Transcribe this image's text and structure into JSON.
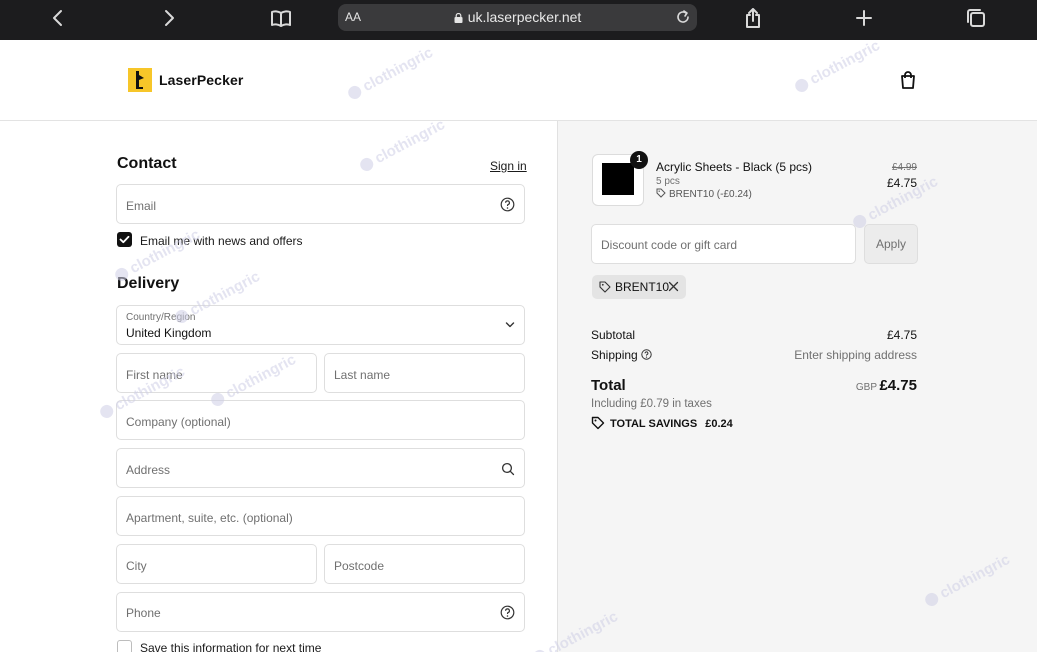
{
  "browser": {
    "aa_label": "AA",
    "url": "uk.laserpecker.net"
  },
  "header": {
    "brand": "LaserPecker"
  },
  "contact": {
    "heading": "Contact",
    "signin": "Sign in",
    "email_placeholder": "Email",
    "marketing_label": "Email me with news and offers",
    "marketing_checked": true
  },
  "delivery": {
    "heading": "Delivery",
    "country_label": "Country/Region",
    "country_value": "United Kingdom",
    "first_name": "First name",
    "last_name": "Last name",
    "company": "Company (optional)",
    "address": "Address",
    "apartment": "Apartment, suite, etc. (optional)",
    "city": "City",
    "postcode": "Postcode",
    "phone": "Phone",
    "save_info_label": "Save this information for next time",
    "save_info_checked": false
  },
  "cart": {
    "item": {
      "quantity": "1",
      "name": "Acrylic Sheets - Black (5 pcs)",
      "variant": "5 pcs",
      "discount": "BRENT10 (-£0.24)",
      "old_price": "£4.99",
      "price": "£4.75"
    },
    "discount_placeholder": "Discount code or gift card",
    "apply_label": "Apply",
    "applied_code": "BRENT10"
  },
  "summary": {
    "subtotal_label": "Subtotal",
    "subtotal_value": "£4.75",
    "shipping_label": "Shipping",
    "shipping_value": "Enter shipping address",
    "total_label": "Total",
    "currency": "GBP",
    "total_value": "£4.75",
    "tax_note": "Including £0.79 in taxes",
    "savings_label": "TOTAL SAVINGS",
    "savings_value": "£0.24"
  },
  "watermark": "clothingric"
}
